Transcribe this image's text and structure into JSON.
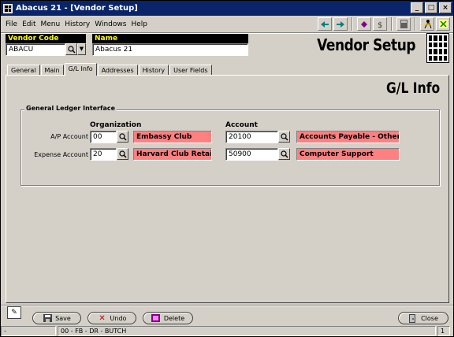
{
  "window": {
    "title": "Abacus 21 - [Vendor Setup]",
    "controls": [
      "_",
      "□",
      "×"
    ]
  },
  "menu": {
    "items": [
      "File",
      "Edit",
      "Menu",
      "History",
      "Windows",
      "Help"
    ]
  },
  "toolbar": {
    "icons": [
      "arrow-left-icon",
      "arrow-right-icon",
      "record-icon",
      "money-icon",
      "calculator-icon",
      "person-icon",
      "help-icon"
    ]
  },
  "header": {
    "vendor_code_label": "Vendor Code",
    "vendor_code_value": "ABACU",
    "name_label": "Name",
    "name_value": "Abacus 21",
    "page_title": "Vendor Setup"
  },
  "tabs": [
    "General",
    "Main",
    "G/L Info",
    "Addresses",
    "History",
    "User Fields"
  ],
  "active_tab": "G/L Info",
  "gl": {
    "section_title": "G/L Info",
    "group_title": "General Ledger Interface",
    "col_org": "Organization",
    "col_account": "Account",
    "rows": [
      {
        "label": "A/P Account",
        "org": "00",
        "org_desc": "Embassy Club",
        "account": "20100",
        "account_desc": "Accounts Payable - Other"
      },
      {
        "label": "Expense Account",
        "org": "20",
        "org_desc": "Harvard Club Retail",
        "account": "50900",
        "account_desc": "Computer Support"
      }
    ]
  },
  "buttons": {
    "save": "Save",
    "undo": "Undo",
    "delete": "Delete",
    "close": "Close"
  },
  "status": {
    "left": "-",
    "center": "00 - FB - DR - BUTCH",
    "right": "1"
  },
  "colors": {
    "title_bar": "#0a246a",
    "label_bg": "#000000",
    "label_fg": "#ffff00",
    "desc_bg": "#ff8080"
  }
}
